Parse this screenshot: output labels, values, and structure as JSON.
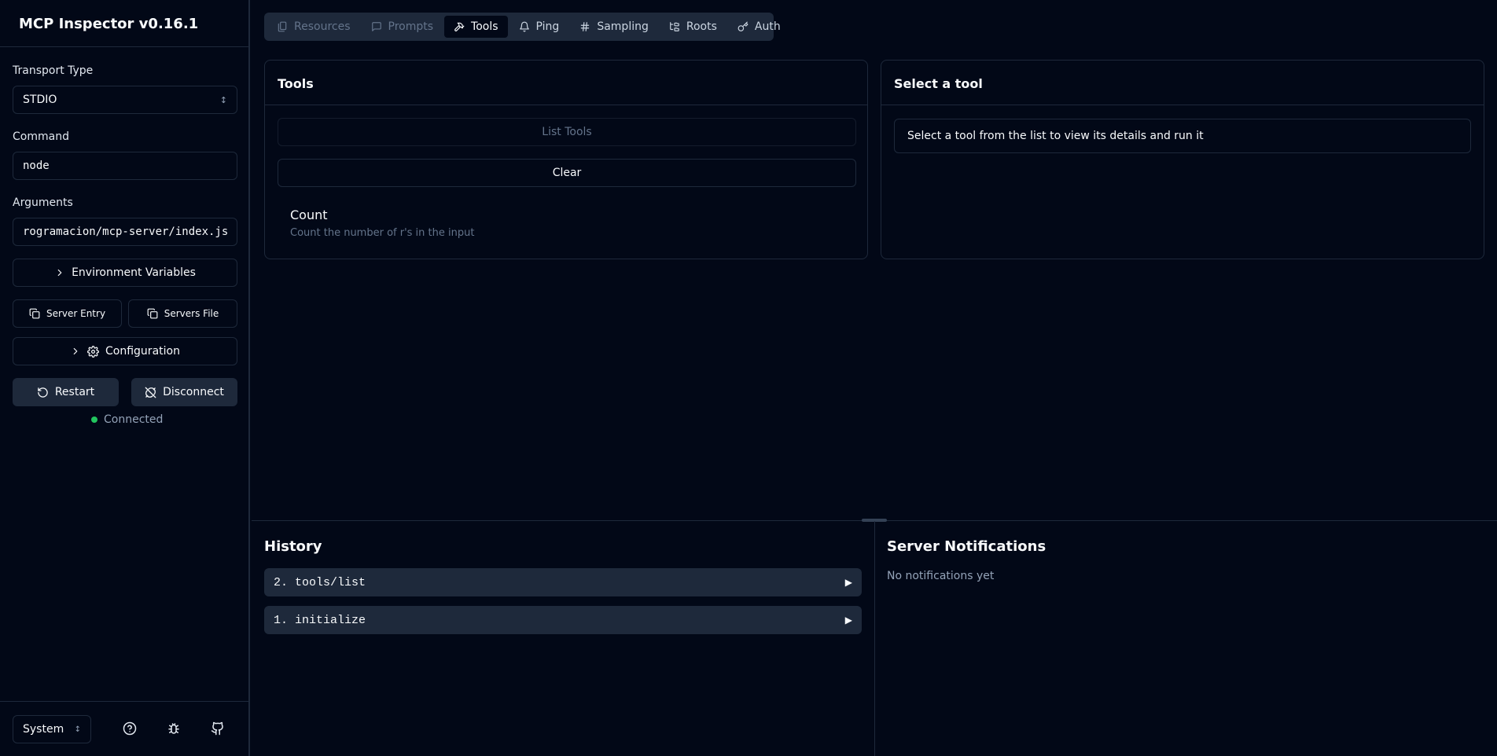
{
  "app": {
    "title": "MCP Inspector v0.16.1"
  },
  "sidebar": {
    "transport_label": "Transport Type",
    "transport_value": "STDIO",
    "command_label": "Command",
    "command_value": "node",
    "arguments_label": "Arguments",
    "arguments_value": "rogramacion/mcp-server/index.js",
    "env_button": "Environment Variables",
    "server_entry_button": "Server Entry",
    "servers_file_button": "Servers File",
    "config_button": "Configuration",
    "restart_button": "Restart",
    "disconnect_button": "Disconnect",
    "status_text": "Connected",
    "status_color": "#22c55e",
    "theme_value": "System"
  },
  "tabs": [
    {
      "label": "Resources",
      "icon": "files-icon",
      "state": "disabled"
    },
    {
      "label": "Prompts",
      "icon": "message-square-icon",
      "state": "disabled"
    },
    {
      "label": "Tools",
      "icon": "hammer-icon",
      "state": "active"
    },
    {
      "label": "Ping",
      "icon": "bell-icon",
      "state": "normal"
    },
    {
      "label": "Sampling",
      "icon": "hash-icon",
      "state": "normal"
    },
    {
      "label": "Roots",
      "icon": "folder-tree-icon",
      "state": "normal"
    },
    {
      "label": "Auth",
      "icon": "key-icon",
      "state": "normal"
    }
  ],
  "tools_panel": {
    "title": "Tools",
    "list_button": "List Tools",
    "clear_button": "Clear",
    "tools": [
      {
        "name": "Count",
        "description": "Count the number of r's in the input"
      }
    ]
  },
  "detail_panel": {
    "title": "Select a tool",
    "message": "Select a tool from the list to view its details and run it"
  },
  "history": {
    "title": "History",
    "items": [
      {
        "label": "2. tools/list"
      },
      {
        "label": "1. initialize"
      }
    ]
  },
  "notifications": {
    "title": "Server Notifications",
    "empty_text": "No notifications yet"
  }
}
